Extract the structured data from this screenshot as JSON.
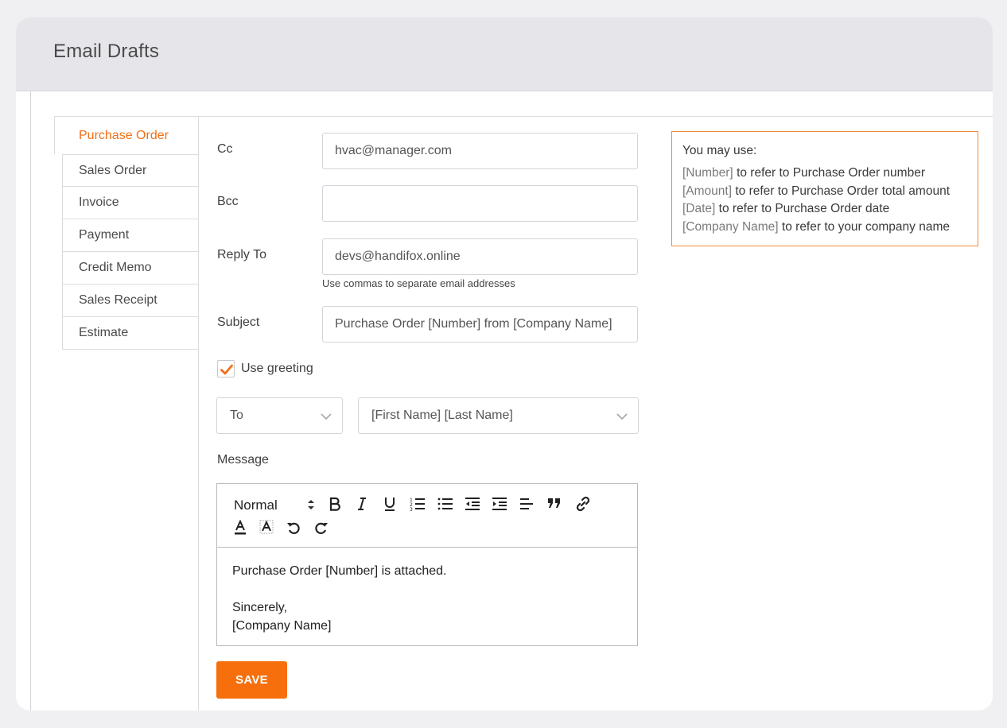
{
  "header": {
    "title": "Email Drafts"
  },
  "sidebar": {
    "active": "Purchase Order",
    "items": [
      {
        "label": "Sales Order"
      },
      {
        "label": "Invoice"
      },
      {
        "label": "Payment"
      },
      {
        "label": "Credit Memo"
      },
      {
        "label": "Sales Receipt"
      },
      {
        "label": "Estimate"
      }
    ]
  },
  "form": {
    "cc": {
      "label": "Cc",
      "value": "hvac@manager.com"
    },
    "bcc": {
      "label": "Bcc",
      "value": ""
    },
    "reply_to": {
      "label": "Reply To",
      "value": "devs@handifox.online",
      "hint": "Use commas to separate email addresses"
    },
    "subject": {
      "label": "Subject",
      "value": "Purchase Order [Number] from [Company Name]"
    },
    "use_greeting": {
      "label": "Use greeting",
      "checked": true
    },
    "greeting_word": "To",
    "greeting_name": "[First Name] [Last Name]",
    "message_label": "Message",
    "save_label": "SAVE"
  },
  "editor": {
    "format": "Normal",
    "lines": [
      "Purchase Order [Number] is attached.",
      "",
      "Sincerely,",
      "[Company Name]"
    ]
  },
  "info": {
    "title": "You may use:",
    "items": [
      {
        "token": "[Number]",
        "text": "to refer to Purchase Order number"
      },
      {
        "token": "[Amount]",
        "text": "to refer to Purchase Order total amount"
      },
      {
        "token": "[Date]",
        "text": "to refer to Purchase Order date"
      },
      {
        "token": "[Company Name]",
        "text": "to refer to your company name"
      }
    ]
  },
  "colors": {
    "accent": "#f66f0c",
    "active_tab": "#f36f17",
    "info_border": "#f0883a"
  },
  "icons": [
    "bold-icon",
    "italic-icon",
    "underline-icon",
    "ordered-list-icon",
    "bullet-list-icon",
    "outdent-icon",
    "indent-icon",
    "align-icon",
    "blockquote-icon",
    "link-icon",
    "font-color-icon",
    "background-color-icon",
    "undo-icon",
    "redo-icon",
    "chevron-down-icon",
    "checkmark-icon"
  ]
}
